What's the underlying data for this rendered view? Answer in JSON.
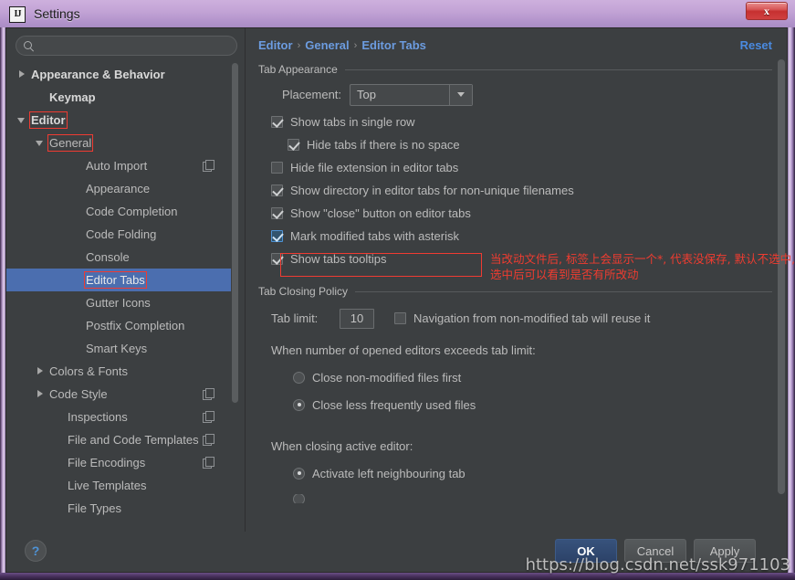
{
  "window": {
    "title": "Settings",
    "app_icon": "intellij-idea-icon",
    "close_label": "x"
  },
  "sidebar": {
    "search": {
      "value": "",
      "placeholder": ""
    },
    "items": [
      {
        "label": "Appearance & Behavior",
        "arrow": "right",
        "indent": 0,
        "bold": true,
        "selected": false,
        "highlight": false,
        "copy_icon": false
      },
      {
        "label": "Keymap",
        "arrow": "none",
        "indent": 1,
        "bold": true,
        "selected": false,
        "highlight": false,
        "copy_icon": false
      },
      {
        "label": "Editor",
        "arrow": "down",
        "indent": 0,
        "bold": true,
        "selected": false,
        "highlight": true,
        "copy_icon": false
      },
      {
        "label": "General",
        "arrow": "down",
        "indent": 1,
        "bold": false,
        "selected": false,
        "highlight": true,
        "copy_icon": false
      },
      {
        "label": "Auto Import",
        "arrow": "none",
        "indent": 3,
        "bold": false,
        "selected": false,
        "highlight": false,
        "copy_icon": true
      },
      {
        "label": "Appearance",
        "arrow": "none",
        "indent": 3,
        "bold": false,
        "selected": false,
        "highlight": false,
        "copy_icon": false
      },
      {
        "label": "Code Completion",
        "arrow": "none",
        "indent": 3,
        "bold": false,
        "selected": false,
        "highlight": false,
        "copy_icon": false
      },
      {
        "label": "Code Folding",
        "arrow": "none",
        "indent": 3,
        "bold": false,
        "selected": false,
        "highlight": false,
        "copy_icon": false
      },
      {
        "label": "Console",
        "arrow": "none",
        "indent": 3,
        "bold": false,
        "selected": false,
        "highlight": false,
        "copy_icon": false
      },
      {
        "label": "Editor Tabs",
        "arrow": "none",
        "indent": 3,
        "bold": false,
        "selected": true,
        "highlight": true,
        "copy_icon": false
      },
      {
        "label": "Gutter Icons",
        "arrow": "none",
        "indent": 3,
        "bold": false,
        "selected": false,
        "highlight": false,
        "copy_icon": false
      },
      {
        "label": "Postfix Completion",
        "arrow": "none",
        "indent": 3,
        "bold": false,
        "selected": false,
        "highlight": false,
        "copy_icon": false
      },
      {
        "label": "Smart Keys",
        "arrow": "none",
        "indent": 3,
        "bold": false,
        "selected": false,
        "highlight": false,
        "copy_icon": false
      },
      {
        "label": "Colors & Fonts",
        "arrow": "right",
        "indent": 1,
        "bold": false,
        "selected": false,
        "highlight": false,
        "copy_icon": false
      },
      {
        "label": "Code Style",
        "arrow": "right",
        "indent": 1,
        "bold": false,
        "selected": false,
        "highlight": false,
        "copy_icon": true
      },
      {
        "label": "Inspections",
        "arrow": "none",
        "indent": 2,
        "bold": false,
        "selected": false,
        "highlight": false,
        "copy_icon": true
      },
      {
        "label": "File and Code Templates",
        "arrow": "none",
        "indent": 2,
        "bold": false,
        "selected": false,
        "highlight": false,
        "copy_icon": true
      },
      {
        "label": "File Encodings",
        "arrow": "none",
        "indent": 2,
        "bold": false,
        "selected": false,
        "highlight": false,
        "copy_icon": true
      },
      {
        "label": "Live Templates",
        "arrow": "none",
        "indent": 2,
        "bold": false,
        "selected": false,
        "highlight": false,
        "copy_icon": false
      },
      {
        "label": "File Types",
        "arrow": "none",
        "indent": 2,
        "bold": false,
        "selected": false,
        "highlight": false,
        "copy_icon": false
      }
    ]
  },
  "content": {
    "breadcrumb": [
      "Editor",
      "General",
      "Editor Tabs"
    ],
    "breadcrumb_separator": "›",
    "reset_label": "Reset",
    "tab_appearance": {
      "title": "Tab Appearance",
      "placement_label": "Placement:",
      "placement_value": "Top",
      "checkboxes": [
        {
          "label": "Show tabs in single row",
          "checked": true,
          "indent": 0,
          "focused": false,
          "highlight": false
        },
        {
          "label": "Hide tabs if there is no space",
          "checked": true,
          "indent": 1,
          "focused": false,
          "highlight": false
        },
        {
          "label": "Hide file extension in editor tabs",
          "checked": false,
          "indent": 0,
          "focused": false,
          "highlight": false
        },
        {
          "label": "Show directory in editor tabs for non-unique filenames",
          "checked": true,
          "indent": 0,
          "focused": false,
          "highlight": false
        },
        {
          "label": "Show \"close\" button on editor tabs",
          "checked": true,
          "indent": 0,
          "focused": false,
          "highlight": false
        },
        {
          "label": "Mark modified tabs with asterisk",
          "checked": true,
          "indent": 0,
          "focused": true,
          "highlight": true
        },
        {
          "label": "Show tabs tooltips",
          "checked": true,
          "indent": 0,
          "focused": false,
          "highlight": false
        }
      ]
    },
    "tab_closing_policy": {
      "title": "Tab Closing Policy",
      "tab_limit_label": "Tab limit:",
      "tab_limit_value": "10",
      "reuse_label": "Navigation from non-modified tab will reuse it",
      "reuse_checked": false,
      "exceeds_label": "When number of opened editors exceeds tab limit:",
      "exceeds_options": [
        {
          "label": "Close non-modified files first",
          "selected": false
        },
        {
          "label": "Close less frequently used files",
          "selected": true
        }
      ],
      "closing_label": "When closing active editor:",
      "closing_options": [
        {
          "label": "Activate left neighbouring tab",
          "selected": true
        }
      ]
    },
    "annotation": {
      "line1": "当改动文件后, 标签上会显示一个*, 代表没保存, 默认不选中,",
      "line2": "选中后可以看到是否有所改动",
      "color": "#f03c30"
    }
  },
  "footer": {
    "help_label": "?",
    "buttons": [
      {
        "label": "OK",
        "primary": true
      },
      {
        "label": "Cancel",
        "primary": false
      },
      {
        "label": "Apply",
        "primary": false
      }
    ]
  },
  "watermark": "https://blog.csdn.net/ssk971103"
}
